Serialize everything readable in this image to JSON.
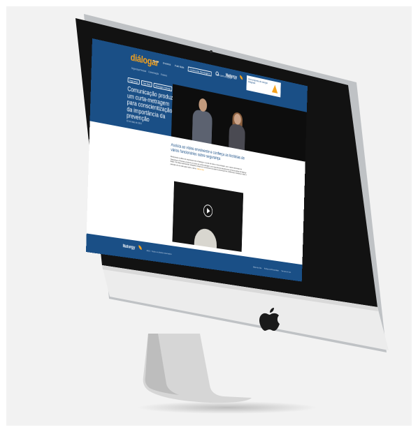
{
  "site": {
    "logo": "diálogar",
    "nav": [
      "Home",
      "Eventos",
      "Fale Mais",
      "Curta uma Mensagem",
      "Fale com a Equipe"
    ],
    "subnav": [
      "Segurança Pessoal",
      "Comunicação",
      "Eventos"
    ],
    "brand": "Naturgy",
    "header_ad": "Uma empresa de energia integrada"
  },
  "hero": {
    "tags": [
      "Segurança",
      "Fale Mais",
      "Mensagem Naturgy"
    ],
    "title": "Comunicação produz um curta-metragem para conscientização da importância da prevenção",
    "date": "02 de maio de 2019"
  },
  "article": {
    "title": "Assista ao vídeo envolvente e conheça as histórias de vários funcionários sobre segurança",
    "body": "Reforçando a cultura de segurança com a Naturgy e o ponto de vista e Comunicação, com o apoio das áreas de Segurança e Pessoas, produziu um vídeo de curta-metragem com importantes depoimentos de funcionários da Naturgy Brasil. Os relatos apresentam situações vividas em momentos nos quais a prevenção fez a diferença. Assista ao vídeo e participe de um bate papo sobre o tema.",
    "more": "Saiba mais"
  },
  "footer": {
    "brand": "Naturgy",
    "copyright": "2019 - Todos os direitos reservados",
    "links": [
      "Mapa do Site",
      "Política de Privacidade",
      "Termos de Uso"
    ]
  },
  "colors": {
    "primary": "#1a4f86",
    "accent": "#f7a21b",
    "bezel": "#111111",
    "chin": "#e9e9e9"
  }
}
